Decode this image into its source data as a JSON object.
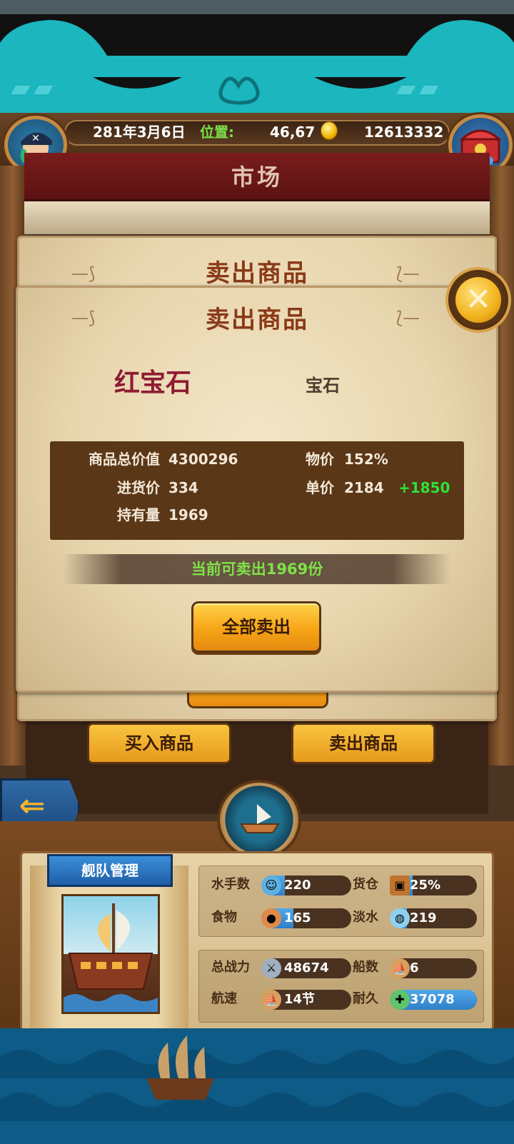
{
  "topbar": {
    "date": "281年3月6日",
    "position_label": "位置:",
    "position_value": "46,67",
    "gold": "12613332"
  },
  "market": {
    "title": "市场"
  },
  "dialog": {
    "back_title": "卖出商品",
    "title": "卖出商品",
    "item_name": "红宝石",
    "item_category": "宝石",
    "stats": {
      "total_value_label": "商品总价值",
      "total_value": "4300296",
      "price_index_label": "物价",
      "price_index": "152%",
      "purchase_price_label": "进货价",
      "purchase_price": "334",
      "unit_price_label": "单价",
      "unit_price": "2184",
      "profit": "+1850",
      "holding_label": "持有量",
      "holding": "1969"
    },
    "available_text": "当前可卖出1969份",
    "sell_all_label": "全部卖出",
    "close_icon": "close-icon"
  },
  "tabs": {
    "buy_label": "买入商品",
    "sell_label": "卖出商品"
  },
  "fleet": {
    "title": "舰队管理",
    "sailors_label": "水手数",
    "sailors": "220",
    "cargo_label": "货仓",
    "cargo": "25%",
    "food_label": "食物",
    "food": "165",
    "water_label": "淡水",
    "water": "219",
    "power_label": "总战力",
    "power": "48674",
    "ships_label": "船数",
    "ships": "6",
    "speed_label": "航速",
    "speed": "14节",
    "durability_label": "耐久",
    "durability": "37078",
    "fills": {
      "sailors": 0.25,
      "cargo": 0.25,
      "food": 0.35,
      "water": 0.18,
      "durability": 1.0
    }
  },
  "colors": {
    "accent": "#f6a516",
    "profit": "#2ee23a",
    "item_name": "#8e1b33",
    "header_teal": "#1bb6be"
  }
}
